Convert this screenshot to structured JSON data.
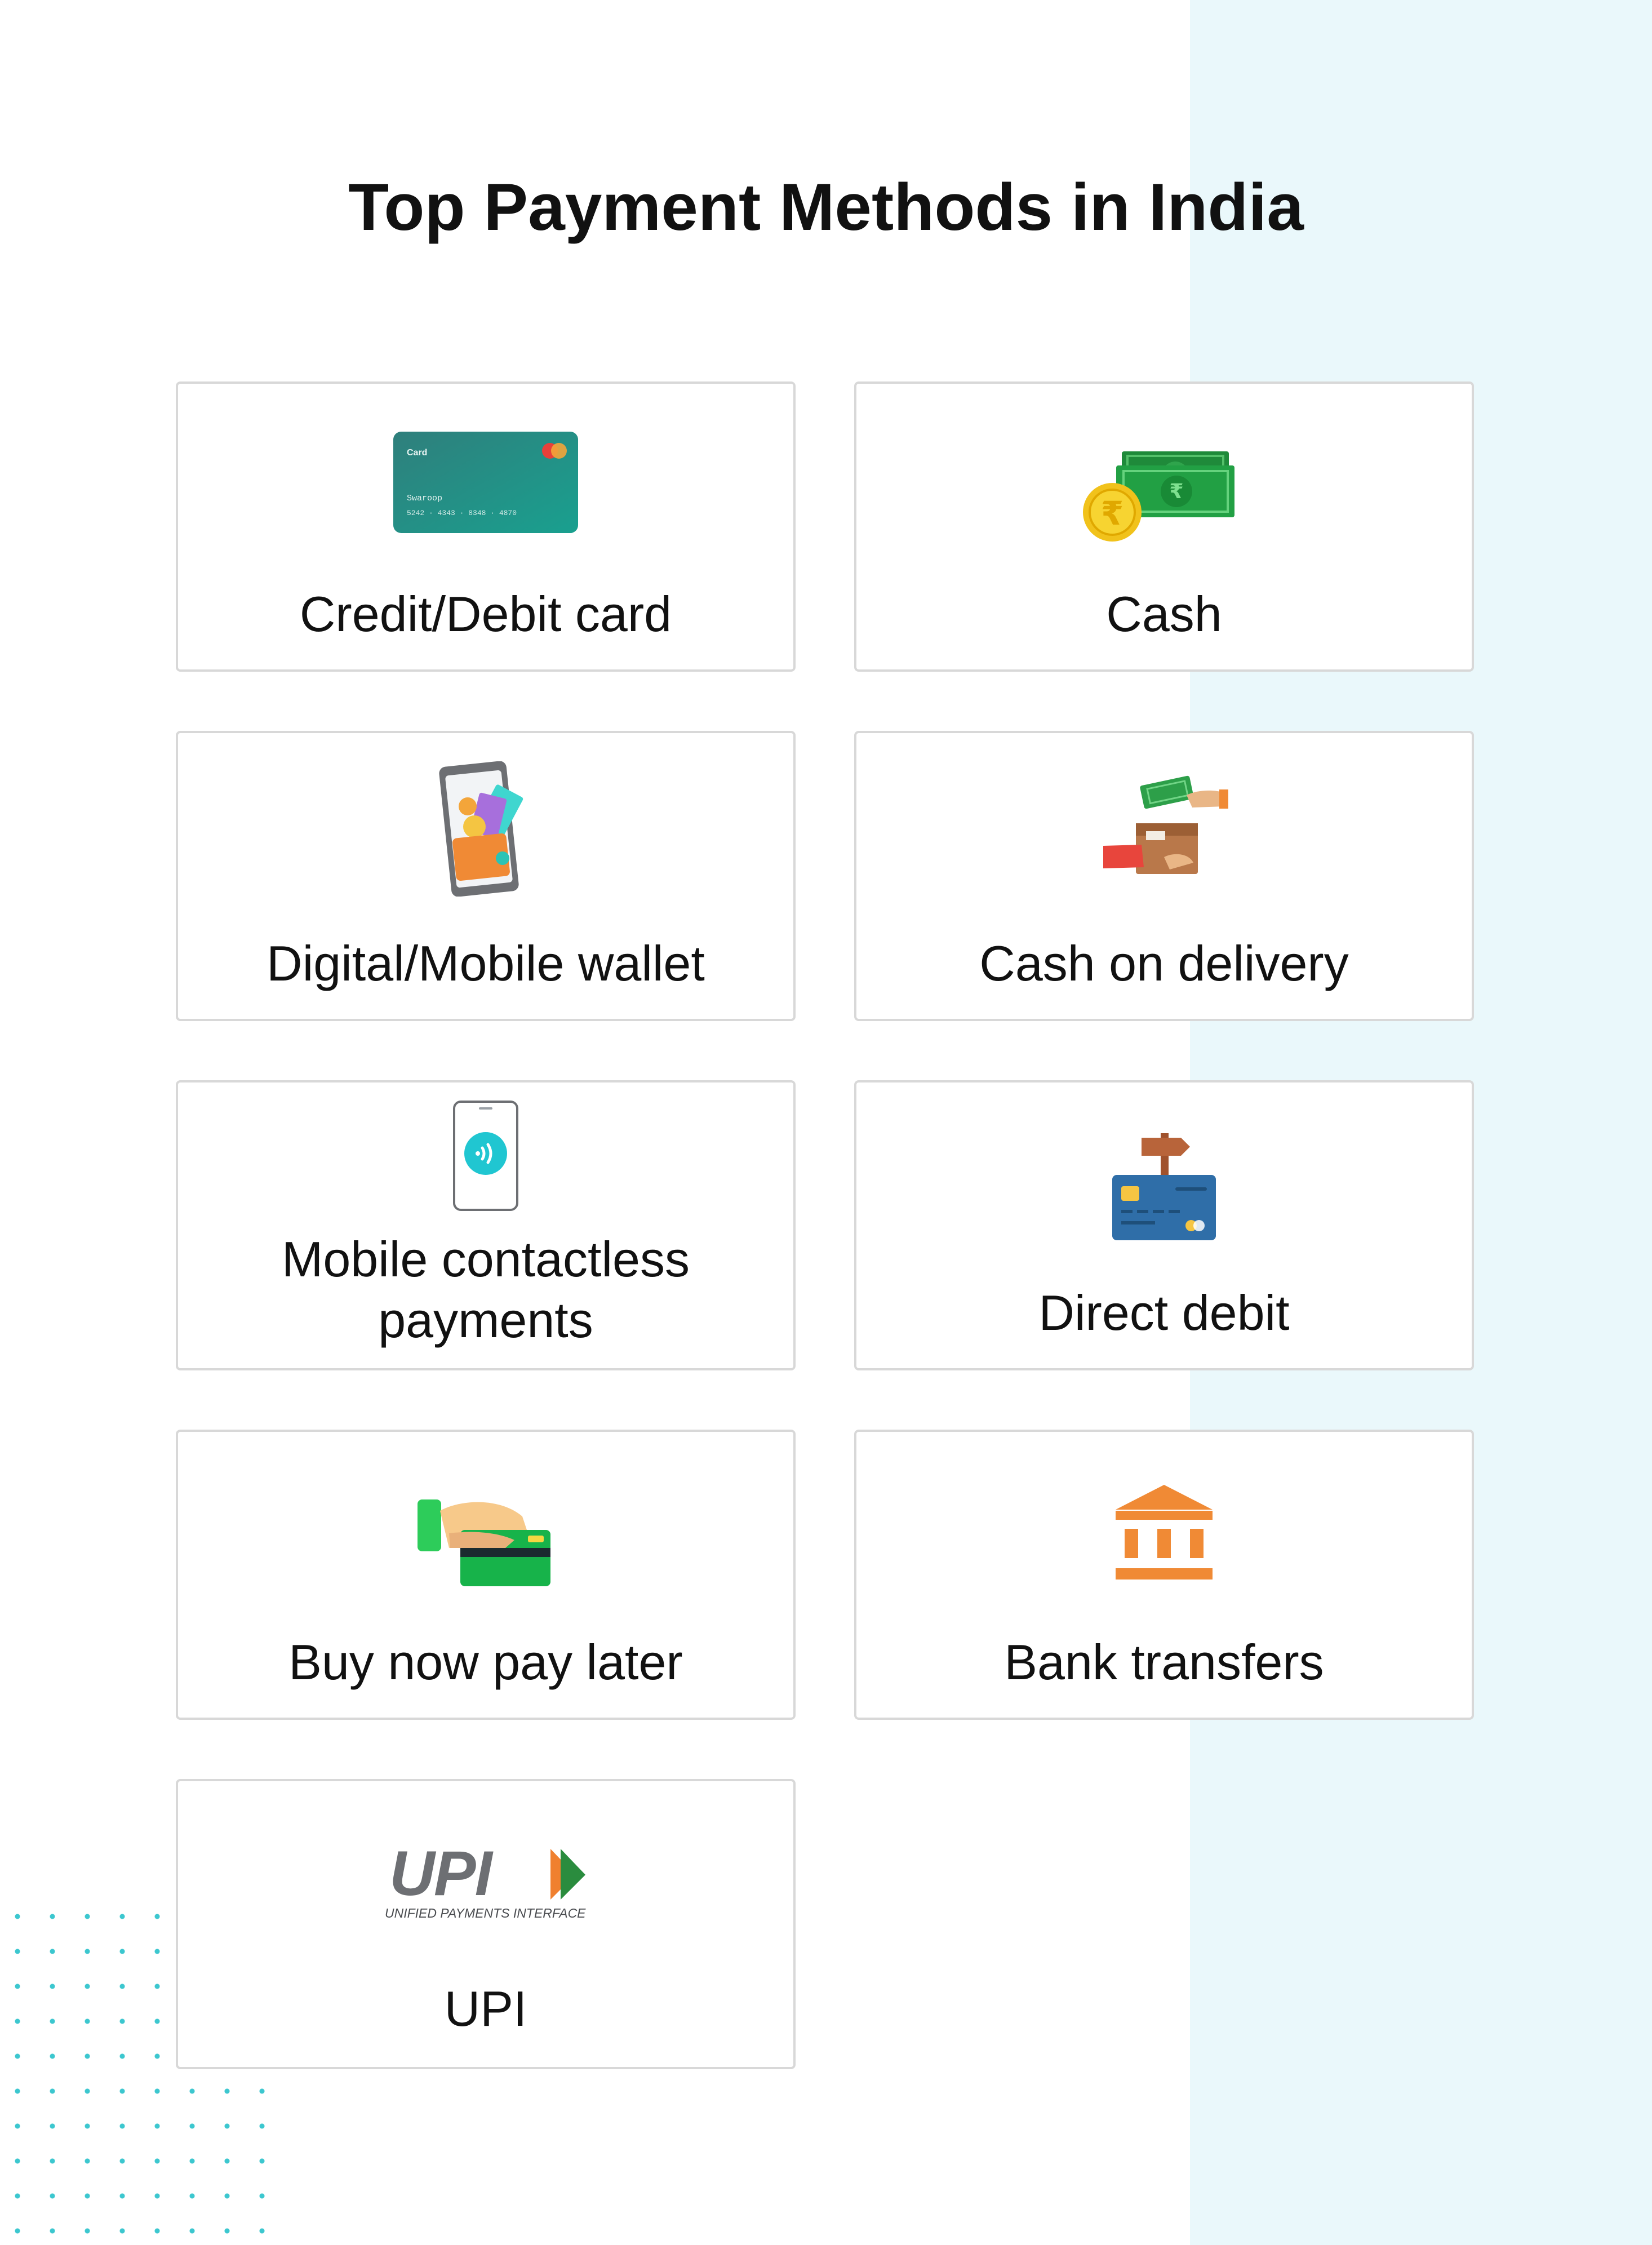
{
  "page": {
    "title": "Top Payment Methods in India"
  },
  "methods": [
    {
      "label": "Credit/Debit card",
      "icon": "credit-card-icon"
    },
    {
      "label": "Cash",
      "icon": "cash-rupee-icon"
    },
    {
      "label": "Digital/Mobile wallet",
      "icon": "mobile-wallet-icon"
    },
    {
      "label": "Cash on delivery",
      "icon": "cash-on-delivery-icon"
    },
    {
      "label": "Mobile contactless payments",
      "label_line1": "Mobile contactless",
      "label_line2": "payments",
      "icon": "contactless-phone-icon"
    },
    {
      "label": "Direct debit",
      "icon": "direct-debit-card-icon"
    },
    {
      "label": "Buy now pay later",
      "icon": "hand-card-icon"
    },
    {
      "label": "Bank transfers",
      "icon": "bank-icon"
    },
    {
      "label": "UPI",
      "icon": "upi-logo-icon"
    }
  ],
  "card_art": {
    "brand": "Card",
    "holder": "Swaroop",
    "number": "5242  ·  4343  ·  8348  ·  4870"
  },
  "upi_logo": {
    "wordmark": "UPI",
    "tagline": "UNIFIED PAYMENTS INTERFACE"
  },
  "colors": {
    "background": "#ffffff",
    "side_panel": "#eaf8fb",
    "dot_accent": "#3cc7cf",
    "card_border": "#d8d8d8",
    "text": "#111111"
  }
}
